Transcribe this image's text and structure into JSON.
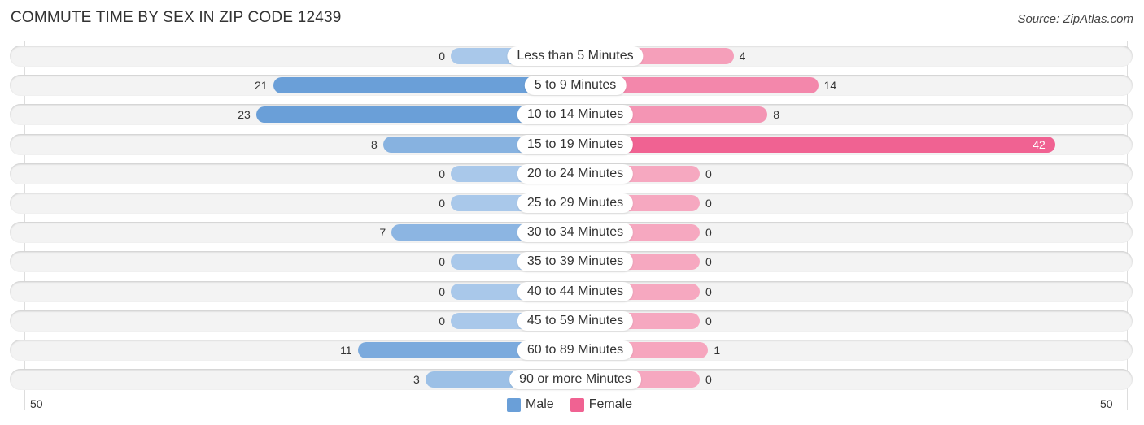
{
  "title": "COMMUTE TIME BY SEX IN ZIP CODE 12439",
  "source": "Source: ZipAtlas.com",
  "colors": {
    "male": "#6a9fd8",
    "female": "#f06292",
    "male_light": "#a9c8ea",
    "female_light": "#f6a8c0"
  },
  "chart_data": {
    "type": "bar",
    "orientation": "horizontal-diverging",
    "title": "COMMUTE TIME BY SEX IN ZIP CODE 12439",
    "categories": [
      "Less than 5 Minutes",
      "5 to 9 Minutes",
      "10 to 14 Minutes",
      "15 to 19 Minutes",
      "20 to 24 Minutes",
      "25 to 29 Minutes",
      "30 to 34 Minutes",
      "35 to 39 Minutes",
      "40 to 44 Minutes",
      "45 to 59 Minutes",
      "60 to 89 Minutes",
      "90 or more Minutes"
    ],
    "series": [
      {
        "name": "Male",
        "values": [
          0,
          21,
          23,
          8,
          0,
          0,
          7,
          0,
          0,
          0,
          11,
          3
        ]
      },
      {
        "name": "Female",
        "values": [
          4,
          14,
          8,
          42,
          0,
          0,
          0,
          0,
          0,
          0,
          1,
          0
        ]
      }
    ],
    "xlim": [
      -50,
      50
    ],
    "axis_ticks": {
      "left": "50",
      "right": "50"
    },
    "legend": {
      "position": "bottom-center",
      "entries": [
        "Male",
        "Female"
      ]
    }
  }
}
